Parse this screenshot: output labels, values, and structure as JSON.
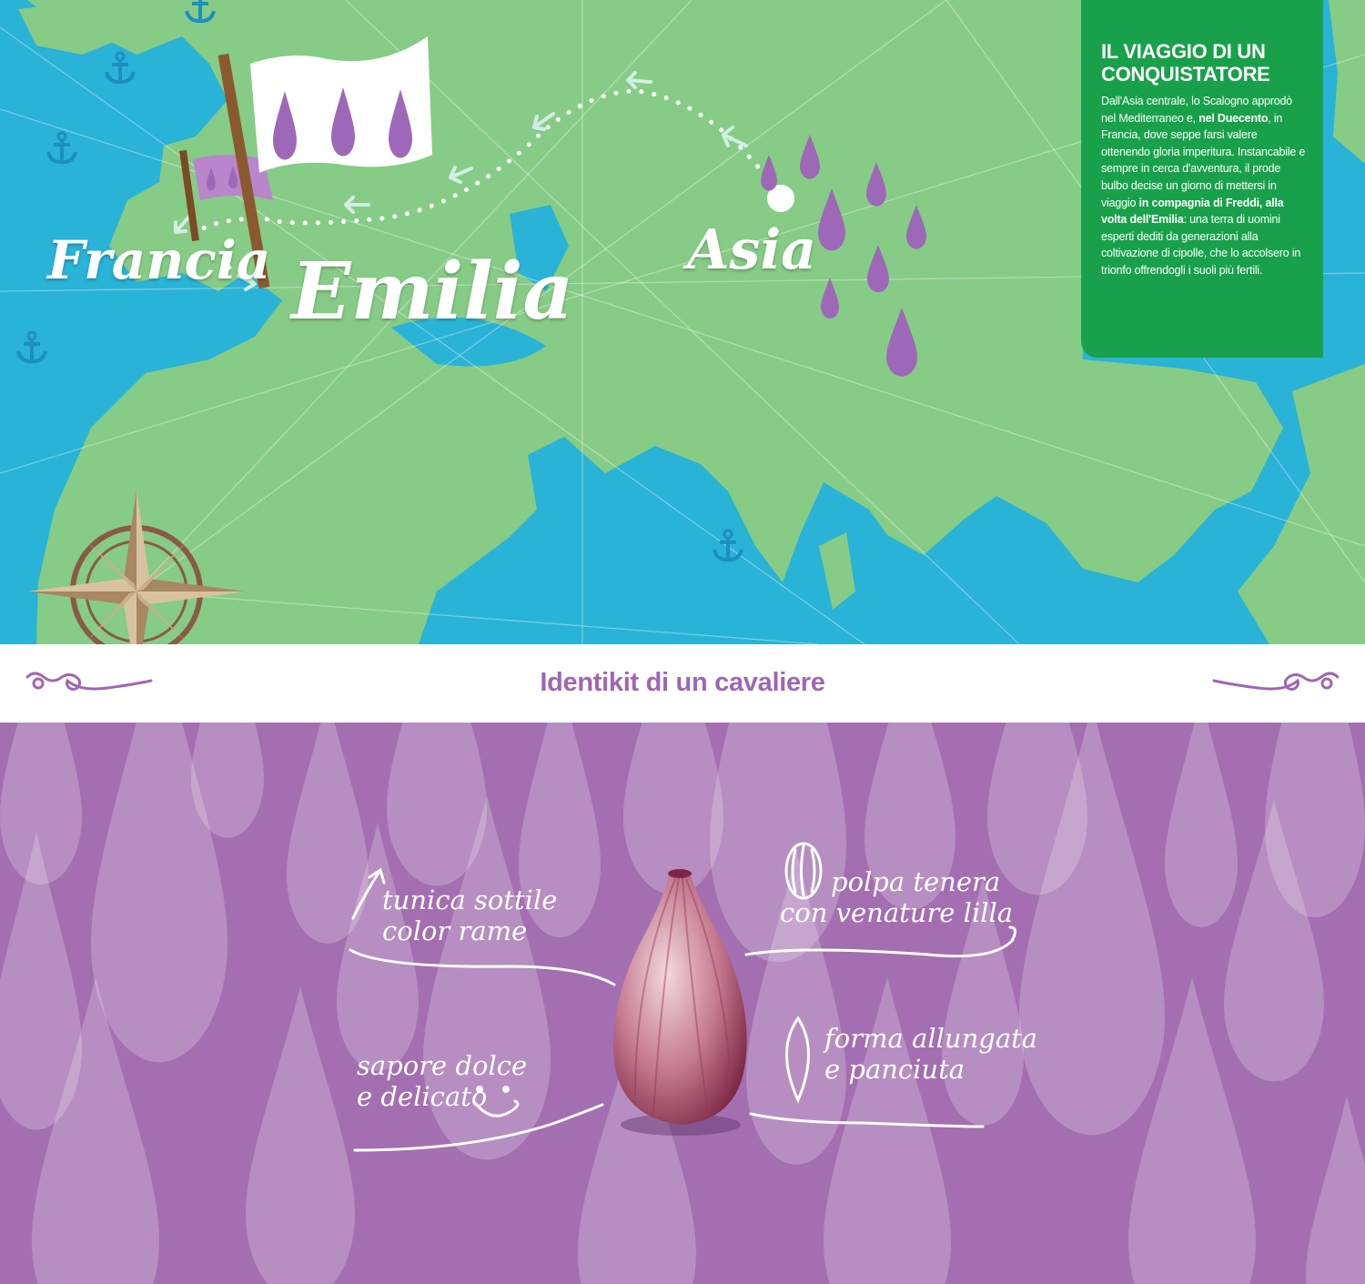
{
  "map": {
    "places": {
      "francia": "Francia",
      "emilia": "Emilia",
      "asia": "Asia"
    },
    "colors": {
      "sea": "#29b3d6",
      "land": "#86cc86",
      "drop": "#9e68b8",
      "box": "#18a14a"
    }
  },
  "infobox": {
    "title_line1": "IL VIAGGIO DI UN",
    "title_line2": "CONQUISTATORE",
    "text_1": "Dall'Asia centrale, lo Scalogno approdò nel Mediterraneo e, ",
    "text_2": "nel Duecento",
    "text_3": ", in Francia, dove seppe farsi valere ottenendo gloria imperitura. Instancabile e sempre in cerca d'avventura, il prode bulbo decise un giorno di mettersi in viaggio ",
    "text_4": "in compagnia di Freddi, alla volta dell'Emilia",
    "text_5": ": una terra di uomini esperti dediti da generazioni alla coltivazione di cipolle, che lo accolsero in trionfo offrendogli i suoli più fertili."
  },
  "section": {
    "title": "Identikit di un cavaliere"
  },
  "features": {
    "tunica_1": "tunica sottile",
    "tunica_2": "color rame",
    "polpa_1": "polpa tenera",
    "polpa_2": "con venature lilla",
    "sapore_1": "sapore dolce",
    "sapore_2": "e delicato",
    "forma_1": "forma allungata",
    "forma_2": "e panciuta"
  }
}
